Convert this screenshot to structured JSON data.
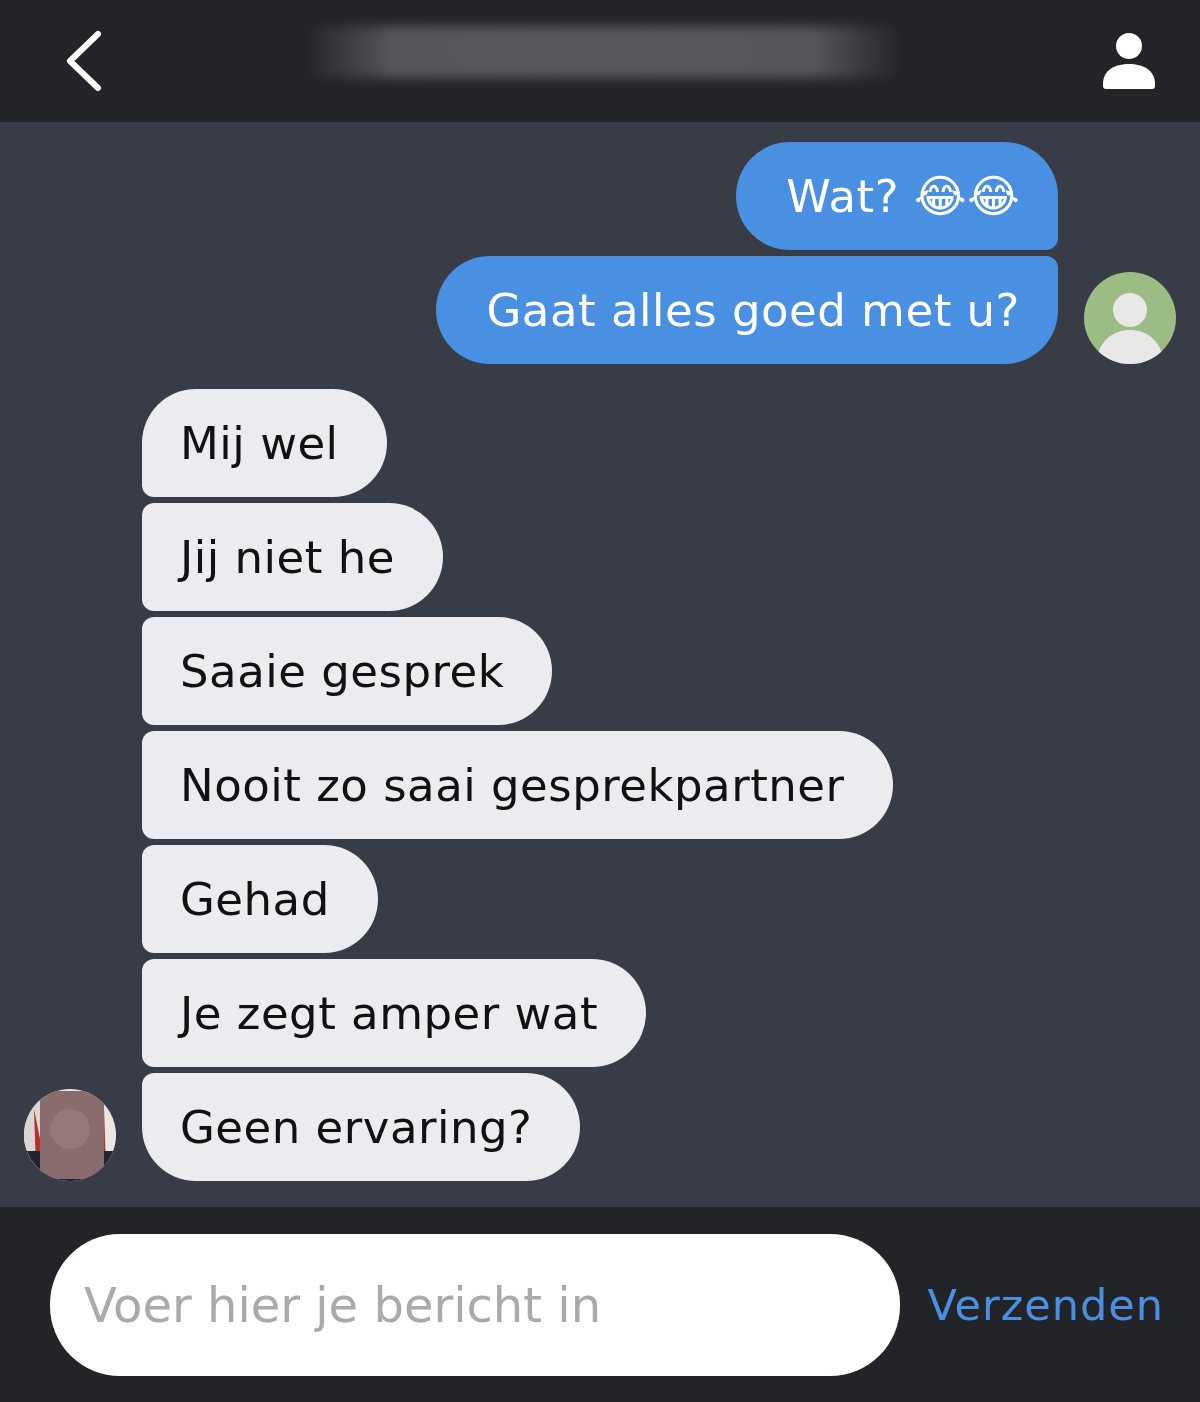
{
  "header": {
    "title_blurred": true
  },
  "groups": [
    {
      "kind": "sent",
      "messages": [
        "Wat? 😂😂",
        "Gaat alles goed met u?"
      ]
    },
    {
      "kind": "received",
      "messages": [
        "Mij wel",
        "Jij niet he",
        "Saaie gesprek",
        "Nooit zo saai gesprekpartner",
        "Gehad",
        "Je zegt amper wat",
        "Geen ervaring?"
      ]
    }
  ],
  "composer": {
    "placeholder": "Voer hier je bericht in",
    "send": "Verzenden"
  }
}
